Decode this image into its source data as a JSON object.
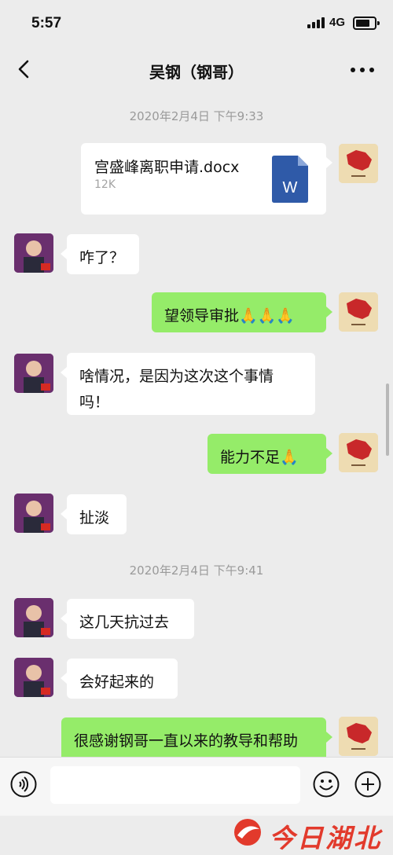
{
  "status_bar": {
    "time": "5:57",
    "network": "4G"
  },
  "header": {
    "title": "吴钢（钢哥）",
    "back_icon": "chevron-left-icon",
    "more_icon": "more-dots-icon"
  },
  "timestamps": [
    "2020年2月4日 下午9:33",
    "2020年2月4日 下午9:41"
  ],
  "file_message": {
    "name": "宫盛峰离职申请.docx",
    "size": "12K",
    "icon": "word-doc-icon"
  },
  "messages": [
    {
      "from": "friend",
      "text": "咋了？"
    },
    {
      "from": "self",
      "text": "望领导审批🙏🙏🙏"
    },
    {
      "from": "friend",
      "text": "啥情况，是因为这次这个事情吗！"
    },
    {
      "from": "self",
      "text": "能力不足🙏"
    },
    {
      "from": "friend",
      "text": "扯淡"
    },
    {
      "from": "friend",
      "text": "这几天抗过去"
    },
    {
      "from": "friend",
      "text": "会好起来的"
    },
    {
      "from": "self",
      "text": "很感谢钢哥一直以来的教导和帮助🙏"
    }
  ],
  "input_bar": {
    "placeholder": "",
    "voice_icon": "voice-icon",
    "emoji_icon": "emoji-icon",
    "plus_icon": "plus-icon"
  },
  "watermark": {
    "text": "今日湖北"
  },
  "colors": {
    "background": "#ececec",
    "outgoing_bubble": "#95ec69",
    "incoming_bubble": "#ffffff",
    "watermark": "#e23a2c"
  }
}
